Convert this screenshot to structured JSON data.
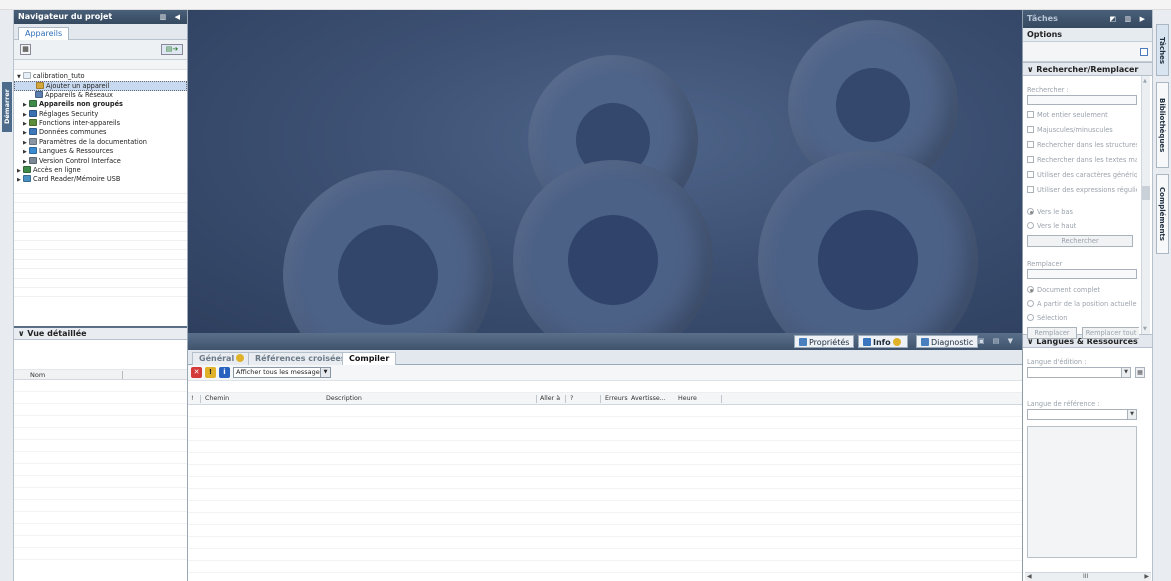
{
  "start_tab": {
    "label": "Démarrer"
  },
  "navigator": {
    "title": "Navigateur du projet",
    "subtab": "Appareils",
    "tree": [
      {
        "label": "calibration_tuto",
        "indent": 0,
        "arrow": "▼",
        "icon_color": "#e6eef8",
        "bold": false,
        "selected": false
      },
      {
        "label": "Ajouter un appareil",
        "indent": 2,
        "arrow": "",
        "icon_color": "#d4a73a",
        "bold": false,
        "selected": true
      },
      {
        "label": "Appareils & Réseaux",
        "indent": 2,
        "arrow": "",
        "icon_color": "#5b7db0",
        "bold": false,
        "selected": false
      },
      {
        "label": "Appareils non groupés",
        "indent": 1,
        "arrow": "▶",
        "icon_color": "#3f8a4a",
        "bold": true,
        "selected": false
      },
      {
        "label": "Réglages Security",
        "indent": 1,
        "arrow": "▶",
        "icon_color": "#3a6fb0",
        "bold": false,
        "selected": false
      },
      {
        "label": "Fonctions inter-appareils",
        "indent": 1,
        "arrow": "▶",
        "icon_color": "#5d8c3a",
        "bold": false,
        "selected": false
      },
      {
        "label": "Données communes",
        "indent": 1,
        "arrow": "▶",
        "icon_color": "#3d78b8",
        "bold": false,
        "selected": false
      },
      {
        "label": "Paramètres de la documentation",
        "indent": 1,
        "arrow": "▶",
        "icon_color": "#8a96a2",
        "bold": false,
        "selected": false
      },
      {
        "label": "Langues & Ressources",
        "indent": 1,
        "arrow": "▶",
        "icon_color": "#3a8ad0",
        "bold": false,
        "selected": false
      },
      {
        "label": "Version Control Interface",
        "indent": 1,
        "arrow": "▶",
        "icon_color": "#7a8896",
        "bold": false,
        "selected": false
      },
      {
        "label": "Accès en ligne",
        "indent": 0,
        "arrow": "▶",
        "icon_color": "#3f8a4a",
        "bold": false,
        "selected": false
      },
      {
        "label": "Card Reader/Mémoire USB",
        "indent": 0,
        "arrow": "▶",
        "icon_color": "#4a90c0",
        "bold": false,
        "selected": false
      }
    ]
  },
  "detail_view": {
    "title": "Vue détaillée",
    "column": "Nom"
  },
  "inspector": {
    "tabs": [
      {
        "label": "Propriétés",
        "icon_color": "#4a7fbf"
      },
      {
        "label": "Info",
        "icon_color": "#3a76c0"
      },
      {
        "label": "Diagnostic",
        "icon_color": "#4a7fbf"
      }
    ],
    "subtabs": [
      "Général",
      "Références croisées",
      "Compiler"
    ],
    "filter": {
      "error_color": "#d43a3a",
      "warning_color": "#e0b22a",
      "info_color": "#2a62c0",
      "select_value": "Afficher tous les messages"
    },
    "columns": [
      "!",
      "Chemin",
      "Description",
      "Aller à",
      "?",
      "Erreurs",
      "Avertisse...",
      "Heure"
    ]
  },
  "tasks": {
    "title": "Tâches",
    "options_title": "Options",
    "search_section": {
      "title": "Rechercher/Remplacer",
      "search_label": "Rechercher :",
      "checkboxes": [
        "Mot entier seulement",
        "Majuscules/minuscules",
        "Rechercher dans les structures",
        "Rechercher dans les textes masqués",
        "Utiliser des caractères génériques",
        "Utiliser des expressions régulières"
      ],
      "directions": [
        {
          "label": "Vers le bas",
          "checked": true
        },
        {
          "label": "Vers le haut",
          "checked": false
        }
      ],
      "search_button": "Rechercher",
      "replace_label": "Remplacer",
      "scopes": [
        {
          "label": "Document complet",
          "checked": true
        },
        {
          "label": "A partir de la position actuelle",
          "checked": false
        },
        {
          "label": "Sélection",
          "checked": false
        }
      ],
      "replace_button": "Remplacer",
      "replace_all_button": "Remplacer tout"
    },
    "lang_section": {
      "title": "Langues & Ressources",
      "edit_lang_label": "Langue d'édition :",
      "ref_lang_label": "Langue de référence :"
    }
  },
  "vertical_tabs": [
    "Tâches",
    "Bibliothèques",
    "Compléments"
  ]
}
